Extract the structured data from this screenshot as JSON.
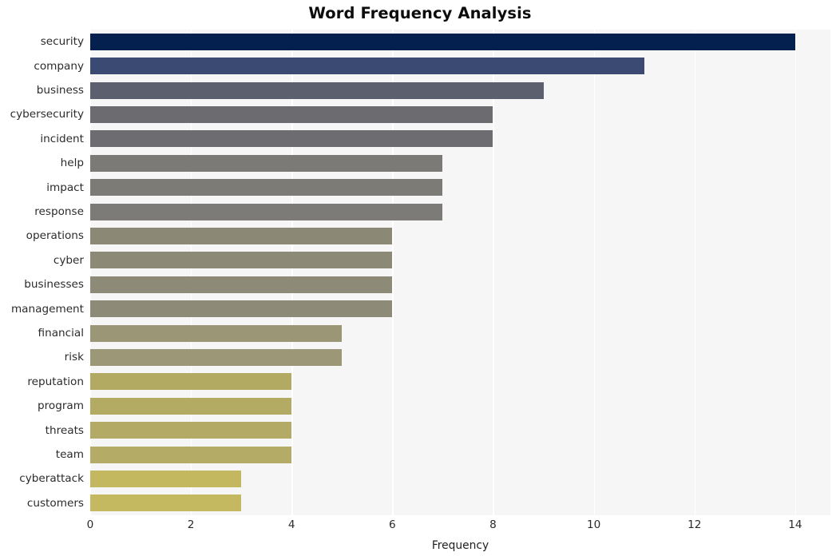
{
  "chart_data": {
    "type": "bar",
    "orientation": "horizontal",
    "title": "Word Frequency Analysis",
    "xlabel": "Frequency",
    "ylabel": "",
    "categories": [
      "security",
      "company",
      "business",
      "cybersecurity",
      "incident",
      "help",
      "impact",
      "response",
      "operations",
      "cyber",
      "businesses",
      "management",
      "financial",
      "risk",
      "reputation",
      "program",
      "threats",
      "team",
      "cyberattack",
      "customers"
    ],
    "values": [
      14,
      11,
      9,
      8,
      8,
      7,
      7,
      7,
      6,
      6,
      6,
      6,
      5,
      5,
      4,
      4,
      4,
      4,
      3,
      3
    ],
    "xticks": [
      0,
      2,
      4,
      6,
      8,
      10,
      12,
      14
    ],
    "xtick_labels": [
      "0",
      "2",
      "4",
      "6",
      "8",
      "10",
      "12",
      "14"
    ],
    "xlim": [
      0,
      14.7
    ],
    "grid": "vertical-white-on-light-gray",
    "legend": "none",
    "bar_colors": [
      "#04204e",
      "#3b4a72",
      "#5b5f6e",
      "#6c6c70",
      "#6d6d71",
      "#7b7a76",
      "#7c7b76",
      "#7c7b77",
      "#8b8876",
      "#8c8976",
      "#8d8a77",
      "#8d8b78",
      "#9b9675",
      "#9c9776",
      "#b2a963",
      "#b3aa64",
      "#b3aa65",
      "#b4ab66",
      "#c3b85f",
      "#c4b960"
    ],
    "plot_background": "#f6f6f7",
    "gridline_color": "#ffffff",
    "title_color": "#0d0d0d",
    "tick_color": "#2b2b2b"
  }
}
